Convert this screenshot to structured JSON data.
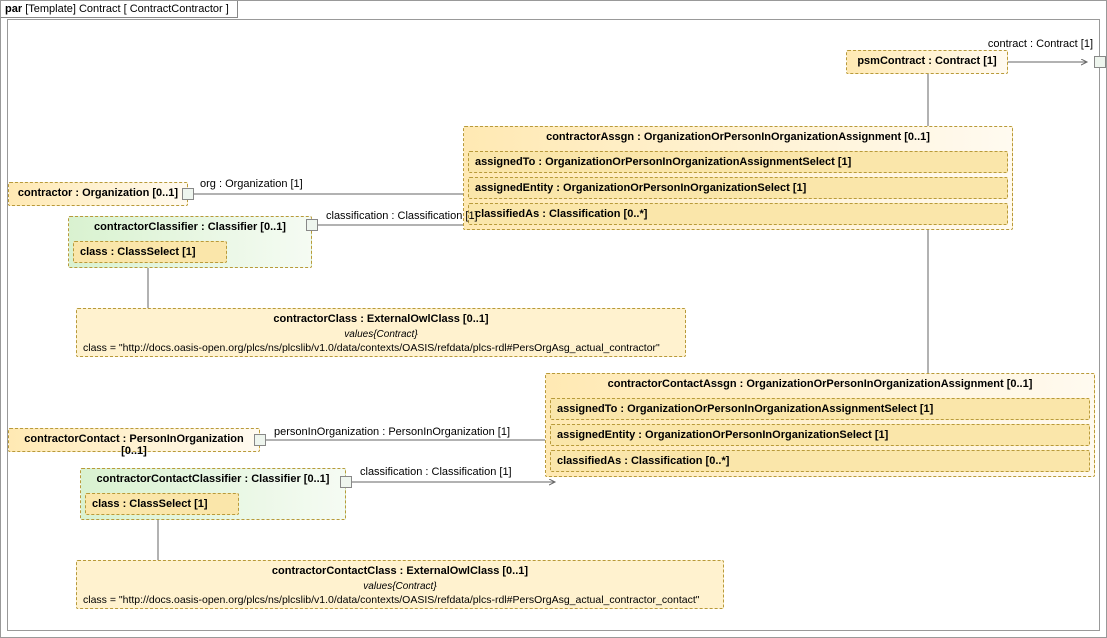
{
  "header": {
    "kind": "par",
    "meta": "[Template] Contract [ ContractContractor ]"
  },
  "psmContract": {
    "title": "psmContract : Contract [1]"
  },
  "contractor": {
    "title": "contractor : Organization [0..1]"
  },
  "contractorClassifier": {
    "title": "contractorClassifier : Classifier [0..1]",
    "classSelect": "class : ClassSelect [1]"
  },
  "contractorClass": {
    "title": "contractorClass : ExternalOwlClass [0..1]",
    "valuesLabel": "values{Contract}",
    "value": "class = \"http://docs.oasis-open.org/plcs/ns/plcslib/v1.0/data/contexts/OASIS/refdata/plcs-rdl#PersOrgAsg_actual_contractor\""
  },
  "contractorAssgn": {
    "title": "contractorAssgn : OrganizationOrPersonInOrganizationAssignment [0..1]",
    "assignedTo": "assignedTo : OrganizationOrPersonInOrganizationAssignmentSelect [1]",
    "assignedEntity": "assignedEntity : OrganizationOrPersonInOrganizationSelect [1]",
    "classifiedAs": "classifiedAs : Classification [0..*]"
  },
  "contractorContact": {
    "title": "contractorContact : PersonInOrganization [0..1]"
  },
  "contractorContactClassifier": {
    "title": "contractorContactClassifier : Classifier [0..1]",
    "classSelect": "class : ClassSelect [1]"
  },
  "contractorContactAssgn": {
    "title": "contractorContactAssgn : OrganizationOrPersonInOrganizationAssignment [0..1]",
    "assignedTo": "assignedTo : OrganizationOrPersonInOrganizationAssignmentSelect [1]",
    "assignedEntity": "assignedEntity : OrganizationOrPersonInOrganizationSelect [1]",
    "classifiedAs": "classifiedAs : Classification [0..*]"
  },
  "contractorContactClass": {
    "title": "contractorContactClass : ExternalOwlClass [0..1]",
    "valuesLabel": "values{Contract}",
    "value": "class = \"http://docs.oasis-open.org/plcs/ns/plcslib/v1.0/data/contexts/OASIS/refdata/plcs-rdl#PersOrgAsg_actual_contractor_contact\""
  },
  "edgeLabels": {
    "contract": "contract : Contract [1]",
    "org": "org : Organization [1]",
    "classification1": "classification : Classification [1]",
    "personInOrg": "personInOrganization : PersonInOrganization [1]",
    "classification2": "classification : Classification [1]"
  }
}
